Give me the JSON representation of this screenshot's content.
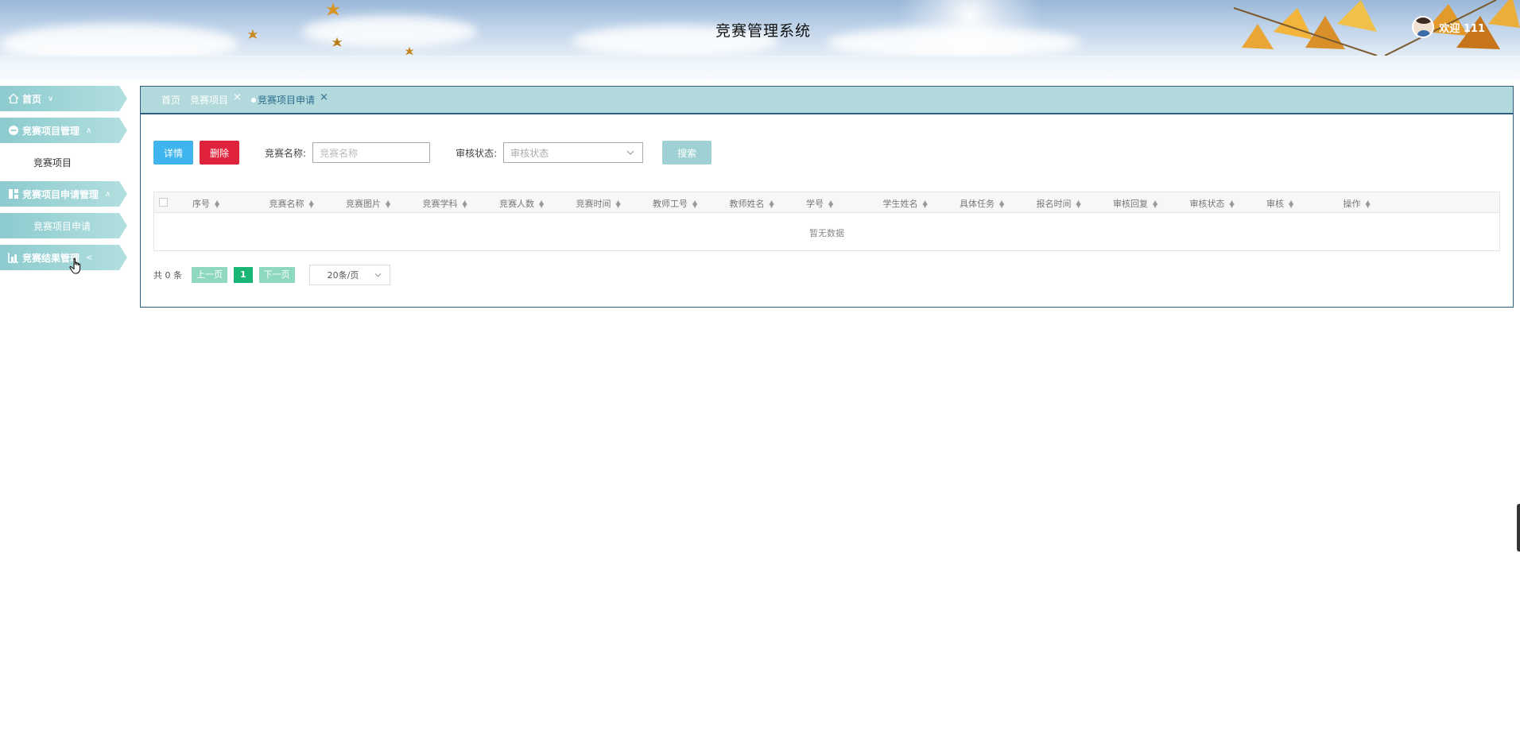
{
  "app": {
    "title": "竞赛管理系统"
  },
  "user": {
    "greeting": "欢迎 111"
  },
  "sidebar": {
    "items": [
      {
        "label": "首页",
        "icon": "home-icon",
        "chevron": "∨"
      },
      {
        "label": "竞赛项目管理",
        "icon": "minus-circle-icon",
        "chevron": "∧"
      },
      {
        "label": "竞赛项目",
        "sub": true
      },
      {
        "label": "竞赛项目申请管理",
        "icon": "grid-icon",
        "chevron": "∧"
      },
      {
        "label": "竞赛项目申请",
        "sub": true,
        "active": true
      },
      {
        "label": "竞赛结果管理",
        "icon": "chart-icon",
        "chevron": "<"
      }
    ]
  },
  "tabs": {
    "home": "首页",
    "project": "竞赛项目",
    "apply": "竞赛项目申请",
    "close": "×"
  },
  "toolbar": {
    "detail_label": "详情",
    "delete_label": "删除",
    "name_label": "竞赛名称:",
    "name_placeholder": "竞赛名称",
    "status_label": "审核状态:",
    "status_placeholder": "审核状态",
    "search_label": "搜索"
  },
  "table": {
    "columns": [
      "序号",
      "竞赛名称",
      "竞赛图片",
      "竞赛学科",
      "竞赛人数",
      "竞赛时间",
      "教师工号",
      "教师姓名",
      "学号",
      "学生姓名",
      "具体任务",
      "报名时间",
      "审核回复",
      "审核状态",
      "审核",
      "操作"
    ],
    "empty_text": "暂无数据"
  },
  "pager": {
    "total": "共 0 条",
    "prev": "上一页",
    "page": "1",
    "next": "下一页",
    "page_size": "20条/页"
  },
  "colors": {
    "accent": "#b2d9db",
    "sidebar": "#8ccbcf",
    "detail": "#3fb4ed",
    "delete": "#e0223d",
    "page_active": "#18b574"
  }
}
